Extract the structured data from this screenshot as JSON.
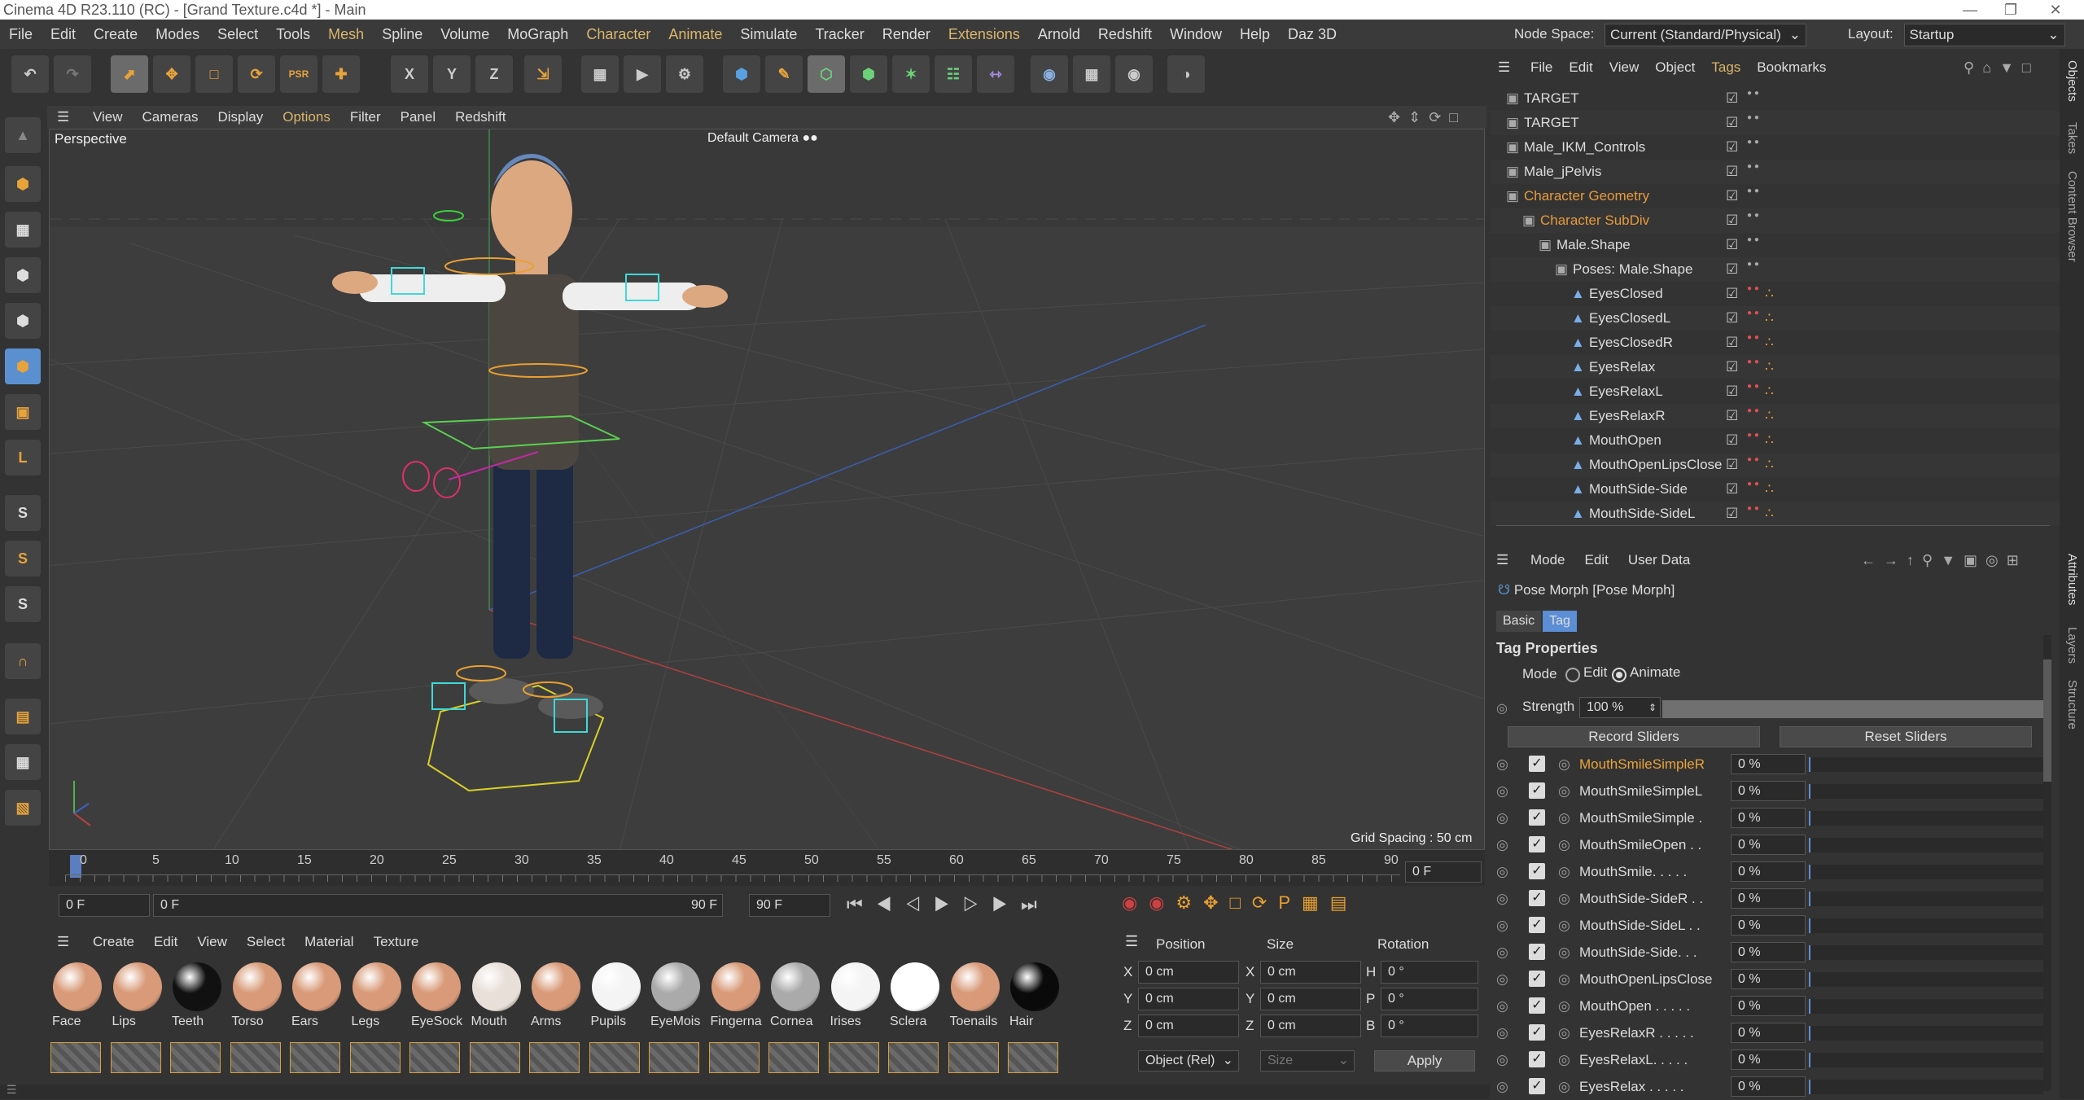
{
  "titlebar": {
    "title": "Cinema 4D R23.110 (RC) - [Grand Texture.c4d *] - Main"
  },
  "menu": {
    "items": [
      "File",
      "Edit",
      "Create",
      "Modes",
      "Select",
      "Tools",
      "Mesh",
      "Spline",
      "Volume",
      "MoGraph",
      "Character",
      "Animate",
      "Simulate",
      "Tracker",
      "Render",
      "Extensions",
      "Arnold",
      "Redshift",
      "Window",
      "Help",
      "Daz 3D"
    ],
    "highlighted": [
      "Mesh",
      "Character",
      "Animate",
      "Extensions"
    ],
    "node_space_label": "Node Space:",
    "node_space_value": "Current (Standard/Physical)",
    "layout_label": "Layout:",
    "layout_value": "Startup"
  },
  "toolbar": {
    "axis": [
      "X",
      "Y",
      "Z"
    ]
  },
  "viewport": {
    "menu": [
      "View",
      "Cameras",
      "Display",
      "Options",
      "Filter",
      "Panel",
      "Redshift"
    ],
    "highlighted": "Options",
    "label": "Perspective",
    "camera": "Default Camera",
    "grid_spacing": "Grid Spacing : 50 cm"
  },
  "timeline": {
    "ticks": [
      "0",
      "5",
      "10",
      "15",
      "20",
      "25",
      "30",
      "35",
      "40",
      "45",
      "50",
      "55",
      "60",
      "65",
      "70",
      "75",
      "80",
      "85",
      "90"
    ],
    "current_right": "0 F"
  },
  "transport": {
    "start": "0 F",
    "range_left": "0 F",
    "range_right": "90 F",
    "end": "90 F"
  },
  "materials": {
    "menu": [
      "Create",
      "Edit",
      "View",
      "Select",
      "Material",
      "Texture"
    ],
    "items": [
      {
        "name": "Face",
        "color": "#d89a78"
      },
      {
        "name": "Lips",
        "color": "#d89a78"
      },
      {
        "name": "Teeth",
        "color": "#111111"
      },
      {
        "name": "Torso",
        "color": "#d89a78"
      },
      {
        "name": "Ears",
        "color": "#d89a78"
      },
      {
        "name": "Legs",
        "color": "#d89a78"
      },
      {
        "name": "EyeSock",
        "color": "#d89a78"
      },
      {
        "name": "Mouth",
        "color": "#e8e0d8"
      },
      {
        "name": "Arms",
        "color": "#d89a78"
      },
      {
        "name": "Pupils",
        "color": "#f4f4f4"
      },
      {
        "name": "EyeMois",
        "color": "#aaaaaa"
      },
      {
        "name": "Fingerna",
        "color": "#d89a78"
      },
      {
        "name": "Cornea",
        "color": "#aaaaaa"
      },
      {
        "name": "Irises",
        "color": "#f4f4f4"
      },
      {
        "name": "Sclera",
        "color": "#ffffff"
      },
      {
        "name": "Toenails",
        "color": "#d89a78"
      },
      {
        "name": "Hair",
        "color": "#0a0a0a"
      }
    ]
  },
  "coords": {
    "headers": [
      "Position",
      "Size",
      "Rotation"
    ],
    "rows": [
      {
        "a": "X",
        "pos": "0 cm",
        "b": "X",
        "size": "0 cm",
        "c": "H",
        "rot": "0 °"
      },
      {
        "a": "Y",
        "pos": "0 cm",
        "b": "Y",
        "size": "0 cm",
        "c": "P",
        "rot": "0 °"
      },
      {
        "a": "Z",
        "pos": "0 cm",
        "b": "Z",
        "size": "0 cm",
        "c": "B",
        "rot": "0 °"
      }
    ],
    "mode": "Object (Rel)",
    "size_mode": "Size",
    "apply": "Apply"
  },
  "objects": {
    "menu": [
      "File",
      "Edit",
      "View",
      "Object",
      "Tags",
      "Bookmarks"
    ],
    "highlighted": "Tags",
    "rows": [
      {
        "name": "TARGET",
        "indent": 0,
        "color": "#dddddd"
      },
      {
        "name": "TARGET",
        "indent": 0,
        "color": "#dddddd"
      },
      {
        "name": "Male_IKM_Controls",
        "indent": 0,
        "color": "#dddddd"
      },
      {
        "name": "Male_jPelvis",
        "indent": 0,
        "color": "#dddddd"
      },
      {
        "name": "Character Geometry",
        "indent": 0,
        "color": "#e69a3c"
      },
      {
        "name": "Character SubDiv",
        "indent": 1,
        "color": "#e69a3c"
      },
      {
        "name": "Male.Shape",
        "indent": 2,
        "color": "#dddddd"
      },
      {
        "name": "Poses: Male.Shape",
        "indent": 3,
        "color": "#dddddd"
      },
      {
        "name": "EyesClosed",
        "indent": 4,
        "color": "#dddddd"
      },
      {
        "name": "EyesClosedL",
        "indent": 4,
        "color": "#dddddd"
      },
      {
        "name": "EyesClosedR",
        "indent": 4,
        "color": "#dddddd"
      },
      {
        "name": "EyesRelax",
        "indent": 4,
        "color": "#dddddd"
      },
      {
        "name": "EyesRelaxL",
        "indent": 4,
        "color": "#dddddd"
      },
      {
        "name": "EyesRelaxR",
        "indent": 4,
        "color": "#dddddd"
      },
      {
        "name": "MouthOpen",
        "indent": 4,
        "color": "#dddddd"
      },
      {
        "name": "MouthOpenLipsClose",
        "indent": 4,
        "color": "#dddddd"
      },
      {
        "name": "MouthSide-Side",
        "indent": 4,
        "color": "#dddddd"
      },
      {
        "name": "MouthSide-SideL",
        "indent": 4,
        "color": "#dddddd"
      }
    ]
  },
  "attributes": {
    "menu": [
      "Mode",
      "Edit",
      "User Data"
    ],
    "object_title": "Pose Morph [Pose Morph]",
    "tabs": [
      "Basic",
      "Tag"
    ],
    "active_tab": "Tag",
    "section": "Tag Properties",
    "mode_label": "Mode",
    "mode_options": [
      "Edit",
      "Animate"
    ],
    "mode_selected": "Animate",
    "strength_label": "Strength",
    "strength_value": "100 %",
    "strength_fraction": 1.0,
    "record_btn": "Record Sliders",
    "reset_btn": "Reset Sliders",
    "sliders": [
      {
        "name": "MouthSmileSimpleR",
        "value": "0 %",
        "highlight": true
      },
      {
        "name": "MouthSmileSimpleL",
        "value": "0 %"
      },
      {
        "name": "MouthSmileSimple .",
        "value": "0 %"
      },
      {
        "name": "MouthSmileOpen . .",
        "value": "0 %"
      },
      {
        "name": "MouthSmile. . . . .",
        "value": "0 %"
      },
      {
        "name": "MouthSide-SideR . .",
        "value": "0 %"
      },
      {
        "name": "MouthSide-SideL . .",
        "value": "0 %"
      },
      {
        "name": "MouthSide-Side. . .",
        "value": "0 %"
      },
      {
        "name": "MouthOpenLipsClose",
        "value": "0 %"
      },
      {
        "name": "MouthOpen . . . . .",
        "value": "0 %"
      },
      {
        "name": "EyesRelaxR . . . . .",
        "value": "0 %"
      },
      {
        "name": "EyesRelaxL. . . . .",
        "value": "0 %"
      },
      {
        "name": "EyesRelax . . . . .",
        "value": "0 %"
      }
    ]
  },
  "sidetabs": {
    "top": [
      "Objects",
      "Takes",
      "Content Browser"
    ],
    "bottom": [
      "Attributes",
      "Layers",
      "Structure"
    ]
  }
}
